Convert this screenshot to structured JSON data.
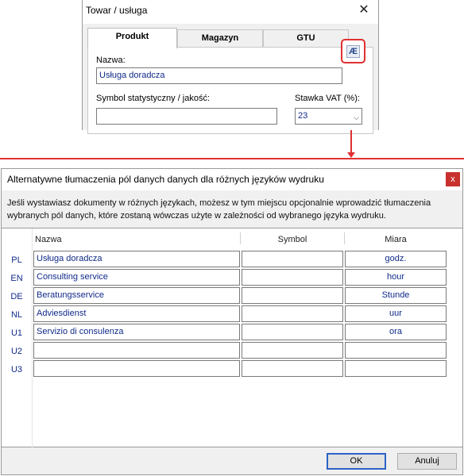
{
  "top_dialog": {
    "title": "Towar / usługa",
    "close_glyph": "✕",
    "tabs": [
      {
        "label": "Produkt",
        "active": true
      },
      {
        "label": "Magazyn",
        "active": false
      },
      {
        "label": "GTU",
        "active": false
      }
    ],
    "name_label": "Nazwa:",
    "name_value": "Usługa doradcza",
    "translate_button_icon": "ae-ligature-icon",
    "translate_button_glyph": "Æ",
    "symbol_label": "Symbol statystyczny / jakość:",
    "symbol_value": "",
    "vat_label": "Stawka VAT (%):",
    "vat_value": "23",
    "highlight_color": "#e03030"
  },
  "main_dialog": {
    "title": "Alternatywne tłumaczenia pól danych danych dla różnych języków wydruku",
    "close_glyph": "x",
    "info_text": "Jeśli wystawiasz dokumenty w różnych językach, możesz w tym miejscu opcjonalnie wprowadzić tłumaczenia wybranych pól danych, które zostaną wówczas użyte w zależności od wybranego języka wydruku.",
    "columns": {
      "name": "Nazwa",
      "symbol": "Symbol",
      "unit": "Miara"
    },
    "rows": [
      {
        "code": "PL",
        "name": "Usługa doradcza",
        "symbol": "",
        "unit": "godz."
      },
      {
        "code": "EN",
        "name": "Consulting service",
        "symbol": "",
        "unit": "hour"
      },
      {
        "code": "DE",
        "name": "Beratungsservice",
        "symbol": "",
        "unit": "Stunde"
      },
      {
        "code": "NL",
        "name": "Adviesdienst",
        "symbol": "",
        "unit": "uur"
      },
      {
        "code": "U1",
        "name": "Servizio di consulenza",
        "symbol": "",
        "unit": "ora"
      },
      {
        "code": "U2",
        "name": "",
        "symbol": "",
        "unit": ""
      },
      {
        "code": "U3",
        "name": "",
        "symbol": "",
        "unit": ""
      }
    ],
    "ok_label": "OK",
    "cancel_label": "Anuluj",
    "text_color": "#102a8a",
    "close_color": "#c8312e"
  }
}
